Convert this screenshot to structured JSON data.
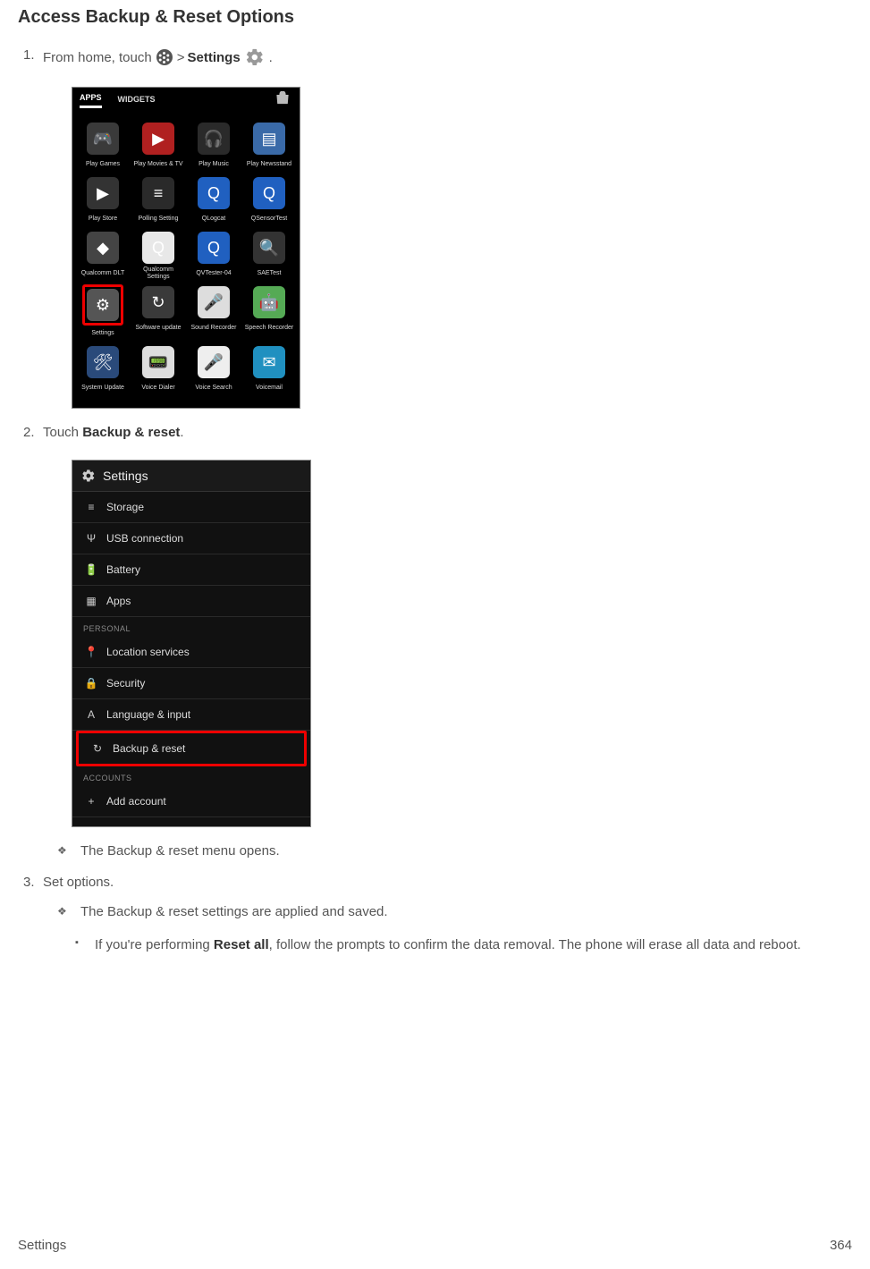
{
  "heading": "Access Backup & Reset Options",
  "step1": {
    "num": "1.",
    "prefix": "From home, touch ",
    "sep": " > ",
    "settings": "Settings",
    "suffix": "."
  },
  "screen1": {
    "tab_apps": "APPS",
    "tab_widgets": "WIDGETS",
    "apps": [
      {
        "label": "Play Games",
        "bg": "#3a3a3a",
        "glyph": "🎮"
      },
      {
        "label": "Play Movies & TV",
        "bg": "#b02020",
        "glyph": "▶"
      },
      {
        "label": "Play Music",
        "bg": "#2a2a2a",
        "glyph": "🎧"
      },
      {
        "label": "Play Newsstand",
        "bg": "#3a6aa8",
        "glyph": "▤"
      },
      {
        "label": "Play Store",
        "bg": "#333",
        "glyph": "▶"
      },
      {
        "label": "Polling Setting",
        "bg": "#2a2a2a",
        "glyph": "≡"
      },
      {
        "label": "QLogcat",
        "bg": "#2060c0",
        "glyph": "Q"
      },
      {
        "label": "QSensorTest",
        "bg": "#2060c0",
        "glyph": "Q"
      },
      {
        "label": "Qualcomm DLT",
        "bg": "#444",
        "glyph": "◆"
      },
      {
        "label": "Qualcomm Settings",
        "bg": "#e8e8e8",
        "glyph": "Q"
      },
      {
        "label": "QVTester-04",
        "bg": "#2060c0",
        "glyph": "Q"
      },
      {
        "label": "SAETest",
        "bg": "#333",
        "glyph": "🔍"
      },
      {
        "label": "Settings",
        "bg": "#555",
        "glyph": "⚙",
        "highlight": true
      },
      {
        "label": "Software update",
        "bg": "#3a3a3a",
        "glyph": "↻"
      },
      {
        "label": "Sound Recorder",
        "bg": "#ddd",
        "glyph": "🎤"
      },
      {
        "label": "Speech Recorder",
        "bg": "#5a5",
        "glyph": "🤖"
      },
      {
        "label": "System Update",
        "bg": "#2a4a7a",
        "glyph": "🛠"
      },
      {
        "label": "Voice Dialer",
        "bg": "#ddd",
        "glyph": "📟"
      },
      {
        "label": "Voice Search",
        "bg": "#eee",
        "glyph": "🎤"
      },
      {
        "label": "Voicemail",
        "bg": "#2090c0",
        "glyph": "✉"
      }
    ]
  },
  "step2": {
    "num": "2.",
    "prefix": "Touch ",
    "bold": "Backup & reset",
    "suffix": "."
  },
  "screen2": {
    "title": "Settings",
    "items": [
      {
        "icon": "≡",
        "label": "Storage"
      },
      {
        "icon": "Ψ",
        "label": "USB connection"
      },
      {
        "icon": "🔋",
        "label": "Battery"
      },
      {
        "icon": "▦",
        "label": "Apps"
      }
    ],
    "section_personal": "PERSONAL",
    "items2": [
      {
        "icon": "📍",
        "label": "Location services"
      },
      {
        "icon": "🔒",
        "label": "Security"
      },
      {
        "icon": "A",
        "label": "Language & input"
      },
      {
        "icon": "↻",
        "label": "Backup & reset",
        "highlight": true
      }
    ],
    "section_accounts": "ACCOUNTS",
    "items3": [
      {
        "icon": "+",
        "label": "Add account"
      }
    ]
  },
  "note1": "The Backup & reset menu opens.",
  "step3": {
    "num": "3.",
    "text": "Set options."
  },
  "note2": "The Backup & reset settings are applied and saved.",
  "note3_prefix": "If you're performing ",
  "note3_bold": "Reset all",
  "note3_suffix": ", follow the prompts to confirm the data removal. The phone will erase all data and reboot.",
  "footer_left": "Settings",
  "footer_right": "364"
}
